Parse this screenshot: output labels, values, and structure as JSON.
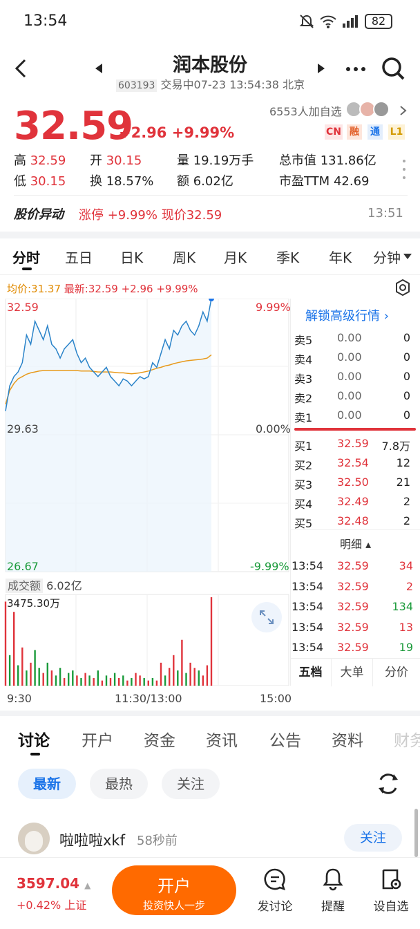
{
  "status_bar": {
    "time": "13:54",
    "battery": "82"
  },
  "header": {
    "title": "润本股份",
    "code": "603193",
    "status": "交易中07-23 13:54:38 北京"
  },
  "quote": {
    "price": "32.59",
    "change": "+2.96",
    "change_pct": "+9.99%",
    "followers": "6553人加自选",
    "badges": [
      "CN",
      "融",
      "通",
      "L1"
    ],
    "stats": [
      {
        "label": "高",
        "value": "32.59"
      },
      {
        "label": "开",
        "value": "30.15"
      },
      {
        "label": "量",
        "value": "19.19万手"
      },
      {
        "label": "总市值",
        "value": "131.86亿"
      },
      {
        "label": "低",
        "value": "30.15"
      },
      {
        "label": "换",
        "value": "18.57%"
      },
      {
        "label": "额",
        "value": "6.02亿"
      },
      {
        "label": "市盈TTM",
        "value": "42.69"
      }
    ],
    "alert": {
      "title": "股价异动",
      "text": "涨停 +9.99% 现价32.59",
      "time": "13:51"
    }
  },
  "chart_tabs": [
    "分时",
    "五日",
    "日K",
    "周K",
    "月K",
    "季K",
    "年K",
    "分钟"
  ],
  "chart_info": {
    "avg": "均价:31.37",
    "latest": "最新:32.59",
    "change": "+2.96",
    "change_pct": "+9.99%"
  },
  "order_book": {
    "unlock_label": "解锁高级行情",
    "asks": [
      {
        "label": "卖5",
        "price": "0.00",
        "vol": "0"
      },
      {
        "label": "卖4",
        "price": "0.00",
        "vol": "0"
      },
      {
        "label": "卖3",
        "price": "0.00",
        "vol": "0"
      },
      {
        "label": "卖2",
        "price": "0.00",
        "vol": "0"
      },
      {
        "label": "卖1",
        "price": "0.00",
        "vol": "0"
      }
    ],
    "bids": [
      {
        "label": "买1",
        "price": "32.59",
        "vol": "7.8万"
      },
      {
        "label": "买2",
        "price": "32.54",
        "vol": "12"
      },
      {
        "label": "买3",
        "price": "32.50",
        "vol": "21"
      },
      {
        "label": "买4",
        "price": "32.49",
        "vol": "2"
      },
      {
        "label": "买5",
        "price": "32.48",
        "vol": "2"
      }
    ],
    "detail_label": "明细",
    "ticks": [
      {
        "time": "13:54",
        "price": "32.59",
        "vol": "34"
      },
      {
        "time": "13:54",
        "price": "32.59",
        "vol": "2"
      },
      {
        "time": "13:54",
        "price": "32.59",
        "vol": "134"
      },
      {
        "time": "13:54",
        "price": "32.59",
        "vol": "13"
      },
      {
        "time": "13:54",
        "price": "32.59",
        "vol": "19"
      }
    ],
    "tabs": [
      "五档",
      "大单",
      "分价"
    ]
  },
  "chart_data": {
    "type": "line",
    "y_labels": {
      "top": "32.59",
      "mid": "29.63",
      "bottom": "26.67",
      "top_pct": "9.99%",
      "mid_pct": "0.00%",
      "bottom_pct": "-9.99%"
    },
    "x_labels": [
      "9:30",
      "11:30/13:00",
      "15:00"
    ],
    "ylim": [
      26.67,
      32.59
    ],
    "price": [
      30.15,
      30.7,
      30.9,
      31.0,
      31.2,
      31.8,
      31.6,
      32.1,
      31.9,
      31.7,
      32.0,
      31.6,
      31.5,
      31.3,
      31.5,
      31.6,
      31.7,
      31.4,
      31.2,
      31.3,
      31.1,
      31.0,
      30.9,
      31.0,
      31.1,
      30.9,
      30.8,
      30.7,
      30.85,
      30.8,
      30.7,
      30.8,
      30.9,
      30.85,
      30.9,
      31.2,
      31.1,
      31.4,
      31.7,
      31.5,
      31.9,
      31.8,
      32.0,
      32.1,
      31.9,
      31.8,
      32.0,
      32.3,
      32.1,
      32.59
    ],
    "avg": [
      30.3,
      30.6,
      30.75,
      30.85,
      30.9,
      30.95,
      30.98,
      31.0,
      31.02,
      31.03,
      31.03,
      31.03,
      31.03,
      31.03,
      31.03,
      31.03,
      31.03,
      31.03,
      31.02,
      31.02,
      31.02,
      31.01,
      31.0,
      31.0,
      31.0,
      31.0,
      30.99,
      30.98,
      30.98,
      30.97,
      30.96,
      30.97,
      30.98,
      31.0,
      31.02,
      31.05,
      31.08,
      31.1,
      31.13,
      31.15,
      31.18,
      31.2,
      31.22,
      31.24,
      31.25,
      31.26,
      31.27,
      31.28,
      31.3,
      31.37
    ],
    "volume_label": "成交额",
    "volume_value": "6.02亿",
    "volume_max": "3475.30万",
    "volume": [
      3300,
      1200,
      2900,
      800,
      1500,
      600,
      900,
      1400,
      700,
      500,
      900,
      600,
      400,
      700,
      300,
      500,
      600,
      400,
      300,
      500,
      400,
      300,
      600,
      200,
      400,
      300,
      500,
      300,
      400,
      200,
      300,
      500,
      400,
      300,
      200,
      300,
      200,
      900,
      400,
      700,
      1200,
      600,
      1800,
      500,
      900,
      700,
      600,
      400,
      800,
      3475
    ],
    "volume_up": [
      true,
      false,
      true,
      false,
      true,
      false,
      true,
      false,
      false,
      true,
      false,
      true,
      false,
      false,
      true,
      false,
      false,
      true,
      false,
      true,
      false,
      true,
      false,
      true,
      false,
      true,
      false,
      true,
      false,
      true,
      false,
      true,
      true,
      false,
      true,
      false,
      true,
      true,
      false,
      true,
      true,
      false,
      true,
      false,
      true,
      true,
      false,
      true,
      true,
      true
    ]
  },
  "bottom_tabs": [
    "讨论",
    "开户",
    "资金",
    "资讯",
    "公告",
    "资料",
    "财务"
  ],
  "discussion_filters": [
    "最新",
    "最热",
    "关注"
  ],
  "post": {
    "user": "啦啦啦xkf",
    "time": "58秒前",
    "follow_label": "关注"
  },
  "footer": {
    "index_value": "3597.04",
    "index_change": "+0.42% 上证",
    "cta_title": "开户",
    "cta_sub": "投资快人一步",
    "actions": [
      "发讨论",
      "提醒",
      "设自选"
    ]
  },
  "colors": {
    "up": "#e0333b",
    "down": "#1a9a3a",
    "accent": "#1a73e8",
    "cta": "#ff6a00"
  }
}
